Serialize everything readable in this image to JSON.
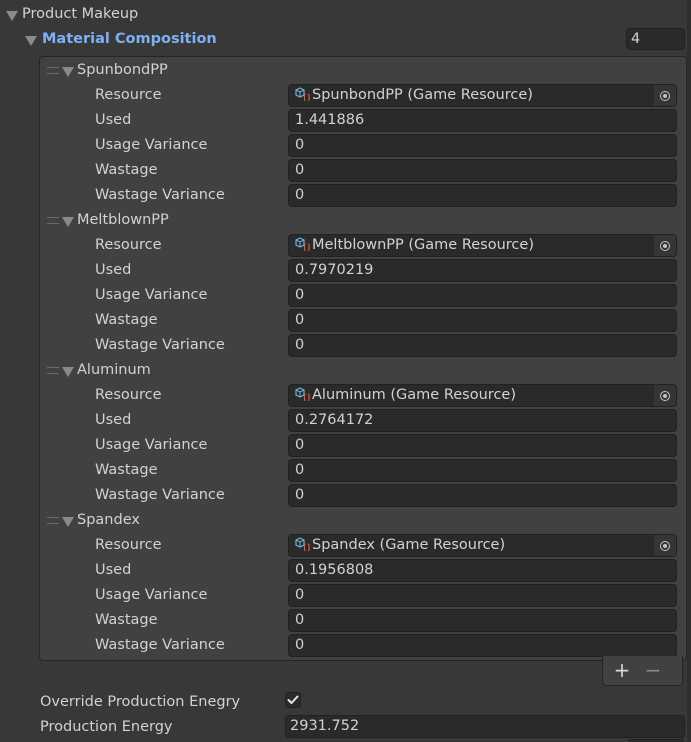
{
  "product_makeup": {
    "title": "Product Makeup",
    "material_composition": {
      "title": "Material Composition",
      "count": "4",
      "field_labels": {
        "resource": "Resource",
        "used": "Used",
        "usage_variance": "Usage Variance",
        "wastage": "Wastage",
        "wastage_variance": "Wastage Variance"
      },
      "items": [
        {
          "name": "SpunbondPP",
          "resource": "SpunbondPP (Game Resource)",
          "used": "1.441886",
          "usage_variance": "0",
          "wastage": "0",
          "wastage_variance": "0"
        },
        {
          "name": "MeltblownPP",
          "resource": "MeltblownPP (Game Resource)",
          "used": "0.7970219",
          "usage_variance": "0",
          "wastage": "0",
          "wastage_variance": "0"
        },
        {
          "name": "Aluminum",
          "resource": "Aluminum (Game Resource)",
          "used": "0.2764172",
          "usage_variance": "0",
          "wastage": "0",
          "wastage_variance": "0"
        },
        {
          "name": "Spandex",
          "resource": "Spandex (Game Resource)",
          "used": "0.1956808",
          "usage_variance": "0",
          "wastage": "0",
          "wastage_variance": "0"
        }
      ],
      "add_button": "+",
      "remove_button": "−"
    },
    "override_production_energy": {
      "label": "Override Production Enegry",
      "checked": true
    },
    "production_energy": {
      "label": "Production Energy",
      "value": "2931.752"
    }
  },
  "colors": {
    "background": "#383838",
    "list_background": "#414141",
    "field_background": "#2a2a2a",
    "accent_title": "#7cb1f5",
    "text": "#d2d2d2"
  }
}
